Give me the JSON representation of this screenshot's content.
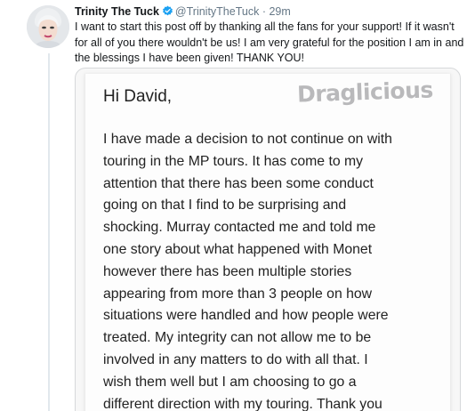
{
  "tweet": {
    "display_name": "Trinity The Tuck",
    "handle": "@TrinityTheTuck",
    "separator": "·",
    "time": "29m",
    "text_lines": [
      "I want to start this post off by thanking all the fans for your support! If it wasn't",
      "for all of you there wouldn't be us! I am very grateful for the position I am in and",
      "the blessings I have been given! THANK YOU!"
    ],
    "icons": {
      "verified": "verified-badge-icon",
      "avatar": "profile-avatar"
    },
    "colors": {
      "verified": "#1da1f2",
      "name": "#14171a",
      "muted": "#657786"
    }
  },
  "letter": {
    "watermark": "Draglicious",
    "greeting": "Hi David,",
    "lines": [
      "I have made a decision to not continue on with",
      "touring in the MP tours. It has come to my",
      "attention that there has been some conduct",
      "going on that I find to be surprising and",
      "shocking. Murray contacted me and told me",
      "one story about what happened with Monet",
      "however there has been multiple stories",
      "appearing from more than 3 people on how",
      "situations were handled and how people were",
      "treated. My integrity can not allow me to be",
      "involved in any matters to do with all that. I",
      "wish them well but I am choosing to go a",
      "different direction with my touring. Thank you"
    ]
  }
}
